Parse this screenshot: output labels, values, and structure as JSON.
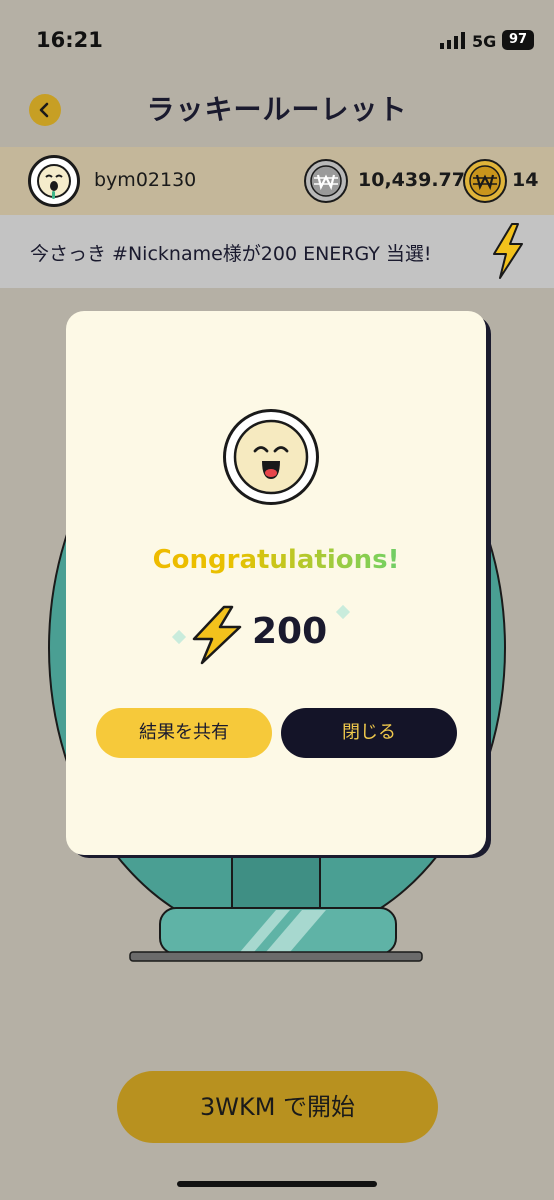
{
  "status": {
    "time": "16:21",
    "network": "5G",
    "battery": "97"
  },
  "header": {
    "title": "ラッキールーレット"
  },
  "user": {
    "name": "bym02130",
    "balance": "10,439.77",
    "tickets": "14"
  },
  "ticker": {
    "text": "今さっき #Nickname様が200 ENERGY 当選!"
  },
  "modal": {
    "title": "Congratulations!",
    "reward_amount": "200",
    "share_label": "結果を共有",
    "close_label": "閉じる"
  },
  "start_button": {
    "label": "3WKM で開始"
  },
  "colors": {
    "accent": "#c79f24",
    "dark": "#141428",
    "share": "#f6c93a"
  },
  "icons": [
    "back-chevron-icon",
    "smiley-avatar-icon",
    "silver-coin-icon",
    "gold-coin-icon",
    "lightning-icon"
  ]
}
